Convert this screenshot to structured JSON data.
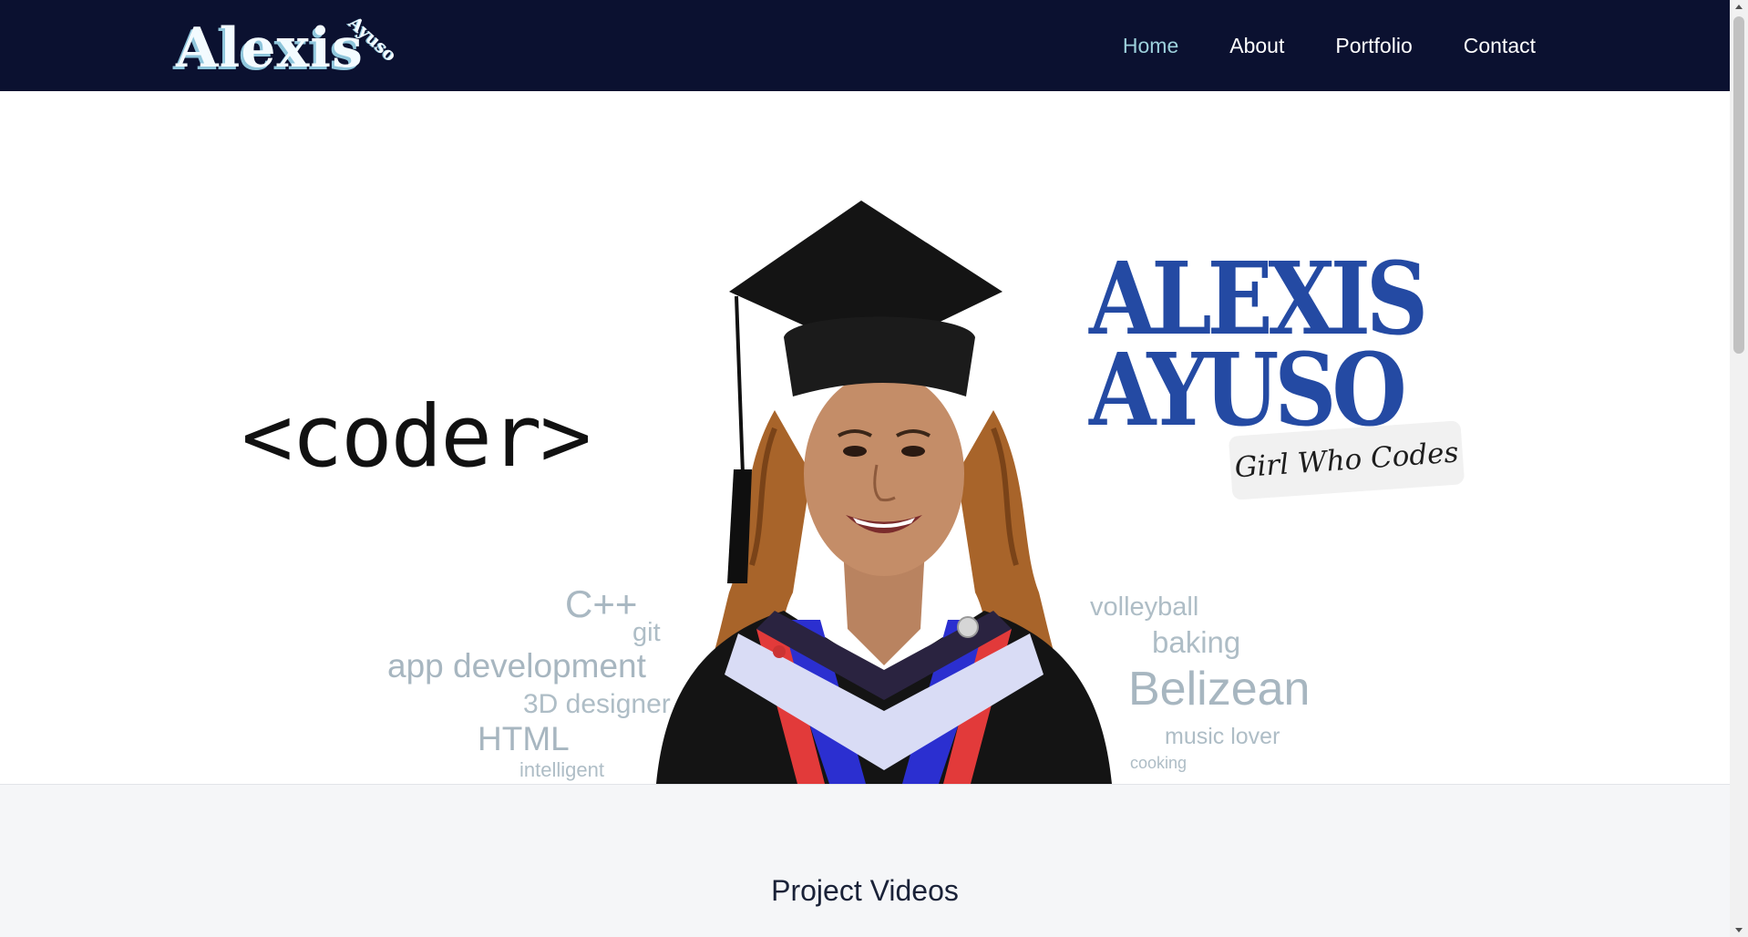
{
  "header": {
    "logo": {
      "main": "Alexis",
      "sub": "Ayuso"
    },
    "nav": [
      {
        "label": "Home",
        "active": true
      },
      {
        "label": "About"
      },
      {
        "label": "Portfolio"
      },
      {
        "label": "Contact"
      }
    ]
  },
  "hero": {
    "coder_text": "<coder>",
    "name_line1": "ALEXIS",
    "name_line2": "AYUSO",
    "tagline": "Girl Who Codes",
    "left_words": [
      "C++",
      "git",
      "app development",
      "3D designer",
      "HTML",
      "intelligent"
    ],
    "right_words": [
      "volleyball",
      "baking",
      "Belizean",
      "music lover",
      "cooking"
    ]
  },
  "sections": {
    "project_videos_title": "Project Videos"
  },
  "colors": {
    "navbar_bg": "#0b1130",
    "nav_active": "#9dd1dc",
    "name_blue": "#244aa3",
    "word_cloud": "#aebdc6",
    "section_bg": "#f5f6f8"
  }
}
